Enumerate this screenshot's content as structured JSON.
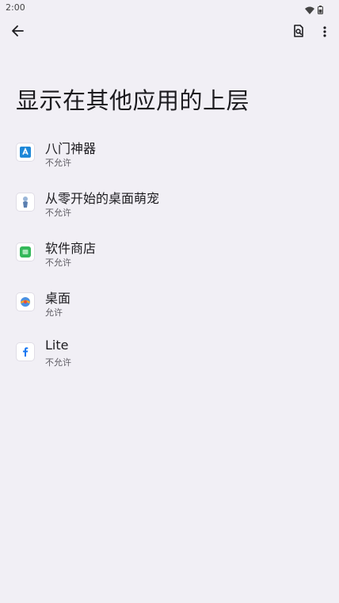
{
  "status_bar": {
    "time": "2:00"
  },
  "page": {
    "title": "显示在其他应用的上层"
  },
  "apps": [
    {
      "name": "八门神器",
      "status": "不允许",
      "icon": "bamen-icon"
    },
    {
      "name": "从零开始的桌面萌宠",
      "status": "不允许",
      "icon": "pet-icon"
    },
    {
      "name": "软件商店",
      "status": "不允许",
      "icon": "store-icon"
    },
    {
      "name": "桌面",
      "status": "允许",
      "icon": "launcher-icon"
    },
    {
      "name": "Lite",
      "status": "不允许",
      "icon": "facebook-lite-icon"
    }
  ],
  "colors": {
    "background": "#f1eff5",
    "text_primary": "#1c1b1f",
    "text_secondary": "#5d5b62"
  }
}
